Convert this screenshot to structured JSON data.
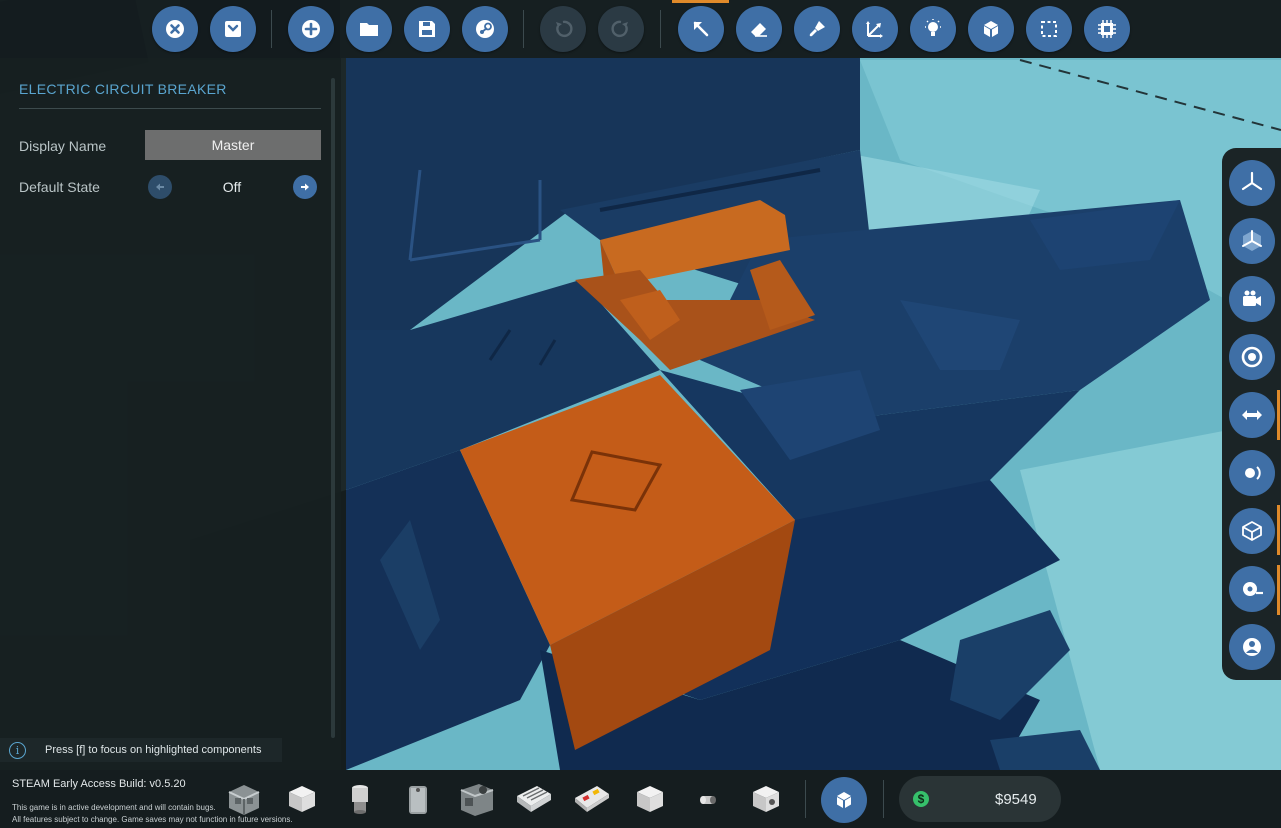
{
  "top_toolbar": {
    "buttons": [
      {
        "icon": "close-circle-icon",
        "enabled": true
      },
      {
        "icon": "collapse-panel-icon",
        "enabled": true
      },
      {
        "icon": "new-vehicle-icon",
        "enabled": true
      },
      {
        "icon": "open-folder-icon",
        "enabled": true
      },
      {
        "icon": "save-icon",
        "enabled": true
      },
      {
        "icon": "steam-workshop-icon",
        "enabled": true
      },
      {
        "icon": "undo-icon",
        "enabled": false
      },
      {
        "icon": "redo-icon",
        "enabled": false
      },
      {
        "icon": "select-cursor-icon",
        "enabled": true,
        "active": true
      },
      {
        "icon": "eraser-icon",
        "enabled": true
      },
      {
        "icon": "paint-brush-icon",
        "enabled": true
      },
      {
        "icon": "move-rotate-icon",
        "enabled": true
      },
      {
        "icon": "lightbulb-icon",
        "enabled": true
      },
      {
        "icon": "blocks-icon",
        "enabled": true
      },
      {
        "icon": "selection-box-icon",
        "enabled": true
      },
      {
        "icon": "microchip-icon",
        "enabled": true
      }
    ]
  },
  "component_panel": {
    "title": "ELECTRIC CIRCUIT BREAKER",
    "display_name_label": "Display Name",
    "display_name_value": "Master",
    "default_state_label": "Default State",
    "default_state_value": "Off"
  },
  "hint": {
    "text": "Press [f] to focus on highlighted components"
  },
  "build_info": {
    "version": "STEAM Early Access Build: v0.5.20",
    "note_line_1": "This game is in active development and will contain bugs.",
    "note_line_2": "All features subject to change. Game saves may not function in future versions."
  },
  "component_bar": {
    "slots": [
      "machinery-block-icon",
      "cube-block-icon",
      "cylinder-light-icon",
      "battery-icon",
      "engine-unit-icon",
      "vent-panel-icon",
      "control-panel-icon",
      "cube-block-icon",
      "small-pipe-icon",
      "connector-block-icon"
    ],
    "inventory_button_icon": "blocks-icon",
    "money": "$9549"
  },
  "right_toolbar": {
    "buttons": [
      "axis-gizmo-icon",
      "axis-cube-icon",
      "camera-icon",
      "target-ring-icon",
      "logic-link-icon",
      "rotation-icon",
      "block-outline-icon",
      "tape-measure-icon",
      "character-view-icon"
    ]
  },
  "colors": {
    "accent_blue": "#3f6fa6",
    "accent_orange": "#e08a2a",
    "title_blue": "#5aa5cf",
    "highlight_orange": "#c25a12",
    "hull_blue": "#16365e",
    "sky_cyan": "#6dbccb"
  }
}
